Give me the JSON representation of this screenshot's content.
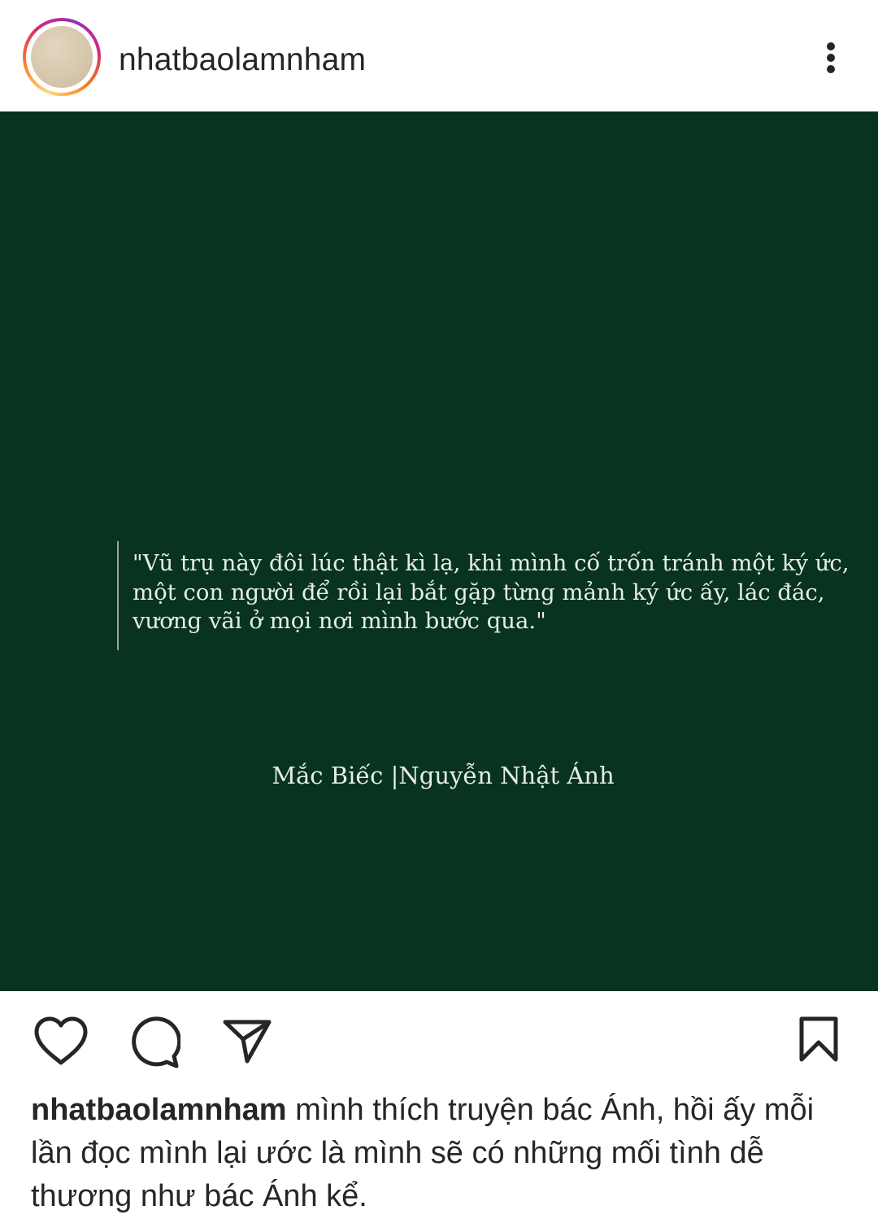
{
  "header": {
    "username": "nhatbaolamnham",
    "more_icon": "more-vertical-icon"
  },
  "post": {
    "background_color": "#07331f",
    "quote_lines": [
      "\"Vũ trụ này đôi lúc thật kì lạ, khi mình cố trốn tránh một ký ức,",
      "một con người để rồi lại bắt gặp từng mảnh ký ức ấy, lác đác,",
      "vương vãi ở mọi nơi mình bước qua.\""
    ],
    "attribution": "Mắc Biếc |Nguyễn Nhật Ánh"
  },
  "actions": {
    "like_icon": "heart-icon",
    "comment_icon": "comment-icon",
    "share_icon": "send-icon",
    "save_icon": "bookmark-icon"
  },
  "caption": {
    "username": "nhatbaolamnham",
    "text": "mình thích truyện bác Ánh, hồi ấy mỗi lần đọc mình lại ước là mình sẽ có những mối tình dễ thương như bác Ánh kể."
  }
}
